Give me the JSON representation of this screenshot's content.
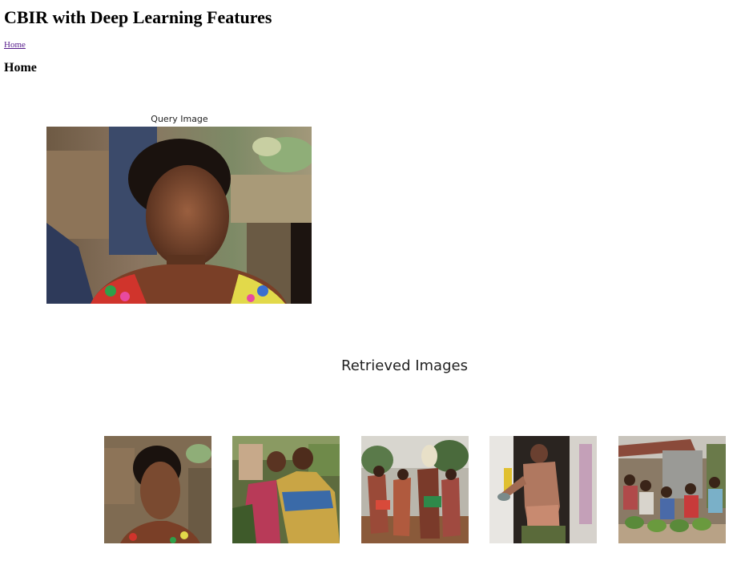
{
  "page": {
    "title": "CBIR with Deep Learning Features",
    "nav_home": "Home",
    "section_heading": "Home"
  },
  "query": {
    "caption": "Query Image",
    "image_icon": "woman-portrait-photo"
  },
  "retrieved": {
    "caption": "Retrieved Images",
    "images": [
      {
        "icon": "woman-portrait-photo"
      },
      {
        "icon": "children-in-woven-shawl-photo"
      },
      {
        "icon": "tribal-dancers-photo"
      },
      {
        "icon": "man-at-doorway-photo"
      },
      {
        "icon": "market-crowd-photo"
      }
    ]
  },
  "colors": {
    "link_visited": "#551a8b",
    "caption_text": "#222222"
  }
}
